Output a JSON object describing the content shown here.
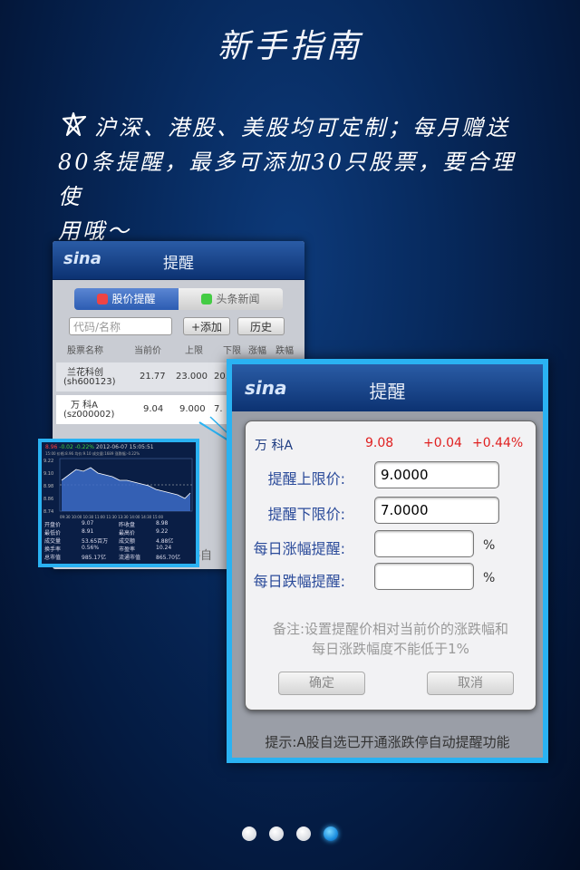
{
  "page": {
    "title": "新手指南"
  },
  "intro": {
    "line1": "沪深、港股、美股均可定制；每月赠送",
    "line2": "80条提醒，最多可添加30只股票，要合理使",
    "line3": "用哦～"
  },
  "back_screen": {
    "logo": "sina",
    "nav_title": "提醒",
    "tabs": [
      "股价提醒",
      "头条新闻"
    ],
    "search_placeholder": "代码/名称",
    "add_button": "+添加",
    "history_button": "历史",
    "columns": [
      "股票名称",
      "当前价",
      "上限",
      "下限",
      "涨幅",
      "跌幅"
    ],
    "rows": [
      {
        "name": "兰花科创",
        "code": "(sh600123)",
        "price": "21.77",
        "upper": "23.000",
        "lower": "20."
      },
      {
        "name": "万 科A",
        "code": "(sz000002)",
        "price": "9.04",
        "upper": "9.000",
        "lower": "7."
      }
    ],
    "footer_partial": "停自"
  },
  "chart_inset": {
    "price": "8.96",
    "change": "-0.02",
    "pct": "-0.22%",
    "datetime": "2012-06-07 15:05:51",
    "sub": "15:00 价格:8.96 均价:9.10 成交量:1689 涨跌幅:-0.22%",
    "y_ticks": [
      "9.22",
      "9.10",
      "8.98",
      "8.86",
      "8.74"
    ],
    "x_ticks": [
      "09:30",
      "10:00",
      "10:30",
      "11:00",
      "11:30",
      "13:30",
      "14:00",
      "14:30",
      "15:00"
    ],
    "stats": [
      [
        "开盘价",
        "9.07",
        "昨收盘",
        "8.98"
      ],
      [
        "最低价",
        "8.91",
        "最高价",
        "9.22"
      ],
      [
        "成交量",
        "53.65百万",
        "成交额",
        "4.88亿"
      ],
      [
        "换手率",
        "0.56%",
        "市盈率",
        "10.24"
      ],
      [
        "总市值",
        "985.17亿",
        "流通市值",
        "865.70亿"
      ]
    ]
  },
  "panel": {
    "logo": "sina",
    "nav_title": "提醒",
    "hint": "提示:A股自选已开通涨跌停自动提醒功能",
    "dialog": {
      "stock_name": "万 科A",
      "price": "9.08",
      "change": "+0.04",
      "change_pct": "+0.44%",
      "upper_label": "提醒上限价:",
      "upper_value": "9.0000",
      "lower_label": "提醒下限价:",
      "lower_value": "7.0000",
      "rise_label": "每日涨幅提醒:",
      "fall_label": "每日跌幅提醒:",
      "pct_unit": "%",
      "note_line1": "备注:设置提醒价相对当前价的涨跌幅和",
      "note_line2": "每日涨跌幅度不能低于1%",
      "confirm": "确定",
      "cancel": "取消"
    }
  },
  "pager": {
    "count": 4,
    "active": 4
  },
  "colors": {
    "accent": "#2ab2f2",
    "up": "#e02020",
    "label": "#2b4b9a"
  }
}
